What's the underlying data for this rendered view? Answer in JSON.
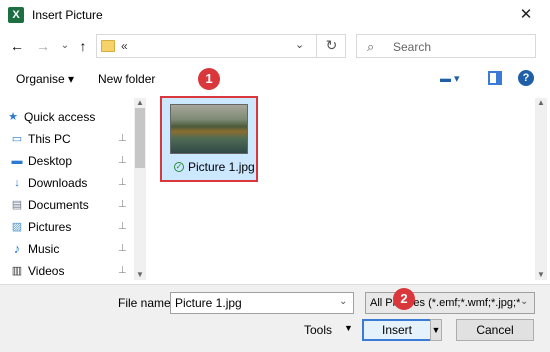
{
  "window": {
    "title": "Insert Picture",
    "app_icon_text": "X"
  },
  "nav": {
    "back": "←",
    "forward": "→",
    "dropdown": "⌄",
    "up": "↑"
  },
  "address": {
    "path": "«",
    "dropdown": "⌄",
    "refresh": "↻"
  },
  "search": {
    "placeholder": "Search",
    "icon": "⌕"
  },
  "toolbar": {
    "organise_label": "Organise ▾",
    "new_folder_label": "New folder",
    "view_icon": "▬ ▾",
    "help_label": "?"
  },
  "sidebar": {
    "items": [
      {
        "label": "Quick access",
        "icon": "★",
        "pinned": false
      },
      {
        "label": "This PC",
        "icon": "▭",
        "pinned": true
      },
      {
        "label": "Desktop",
        "icon": "▬",
        "pinned": true
      },
      {
        "label": "Downloads",
        "icon": "↓",
        "pinned": true
      },
      {
        "label": "Documents",
        "icon": "▤",
        "pinned": true
      },
      {
        "label": "Pictures",
        "icon": "▨",
        "pinned": true
      },
      {
        "label": "Music",
        "icon": "♪",
        "pinned": true
      },
      {
        "label": "Videos",
        "icon": "▥",
        "pinned": true
      }
    ],
    "pin_glyph": "📌"
  },
  "files": [
    {
      "name": "Picture 1.jpg",
      "status_glyph": "✓"
    }
  ],
  "annotations": {
    "badge1": "1",
    "badge2": "2"
  },
  "bottom": {
    "filename_label": "File name:",
    "filename_value": "Picture 1.jpg",
    "filetype_value": "All Pictures (*.emf;*.wmf;*.jpg;*",
    "tools_label": "Tools",
    "insert_label": "Insert",
    "cancel_label": "Cancel",
    "dropdown_glyph": "⌄"
  },
  "colors": {
    "highlight": "#d9373b",
    "selection": "#cce8ff",
    "accent": "#3a7bd5"
  }
}
